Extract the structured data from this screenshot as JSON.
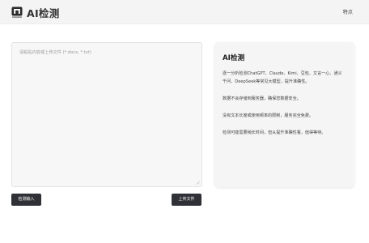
{
  "header": {
    "logo_icon": "ai-detector-logo-icon",
    "title": "AI检测",
    "nav_link": "特点"
  },
  "editor": {
    "placeholder": "请粘贴内容或上传文件 (*.docx, *.txt)",
    "value": ""
  },
  "actions": {
    "detect_label": "检测输入",
    "upload_label": "上传文件"
  },
  "info": {
    "title": "AI检测",
    "paragraphs": [
      "逐一分析检测ChatGPT、Claude、Kimi、豆包、文言一心、通义千问、DeepSeek等常见大模型，提升准确性。",
      "数据不会存储到服务器，确保您数据安全。",
      "没有文本长度或使用频率的限制，服务完全免费。",
      "检测可能需要稍长时间，但从提升准确性看，值得等待。"
    ]
  },
  "colors": {
    "header_bg": "#f4f4f4",
    "button_bg": "#2f3136",
    "card_bg": "#f5f5f5"
  }
}
